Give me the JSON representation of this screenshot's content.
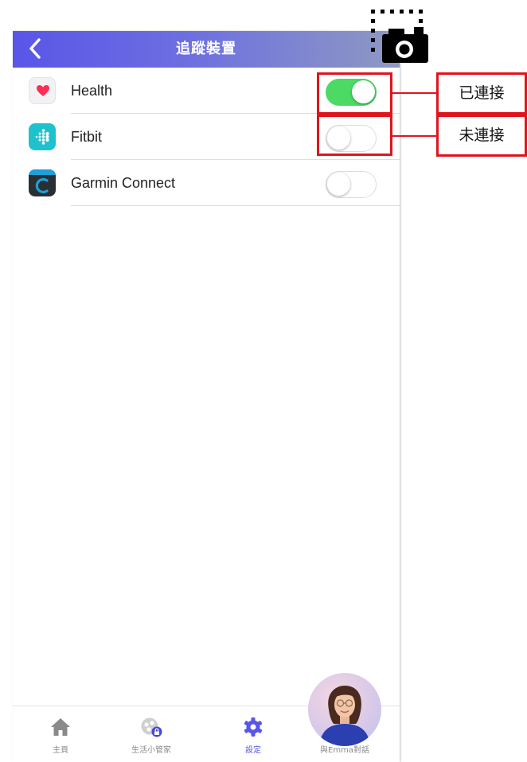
{
  "header": {
    "title": "追蹤裝置"
  },
  "devices": [
    {
      "name": "Health",
      "icon": "apple-health-icon",
      "connected": true
    },
    {
      "name": "Fitbit",
      "icon": "fitbit-icon",
      "connected": false
    },
    {
      "name": "Garmin Connect",
      "icon": "garmin-connect-icon",
      "connected": false
    }
  ],
  "tabbar": {
    "items": [
      {
        "label": "主頁",
        "icon": "home-icon"
      },
      {
        "label": "生活小管家",
        "icon": "locked-helper-icon"
      },
      {
        "label": "設定",
        "icon": "gear-icon",
        "active": true
      },
      {
        "label": "與Emma對話",
        "icon": "emma-avatar"
      }
    ]
  },
  "annotations": {
    "connected_label": "已連接",
    "not_connected_label": "未連接"
  },
  "colors": {
    "header_gradient_start": "#5a55e8",
    "header_gradient_end": "#8f99c2",
    "toggle_on": "#4cd964",
    "annotation_red": "#e0141e",
    "active_tab": "#5a55e8"
  }
}
